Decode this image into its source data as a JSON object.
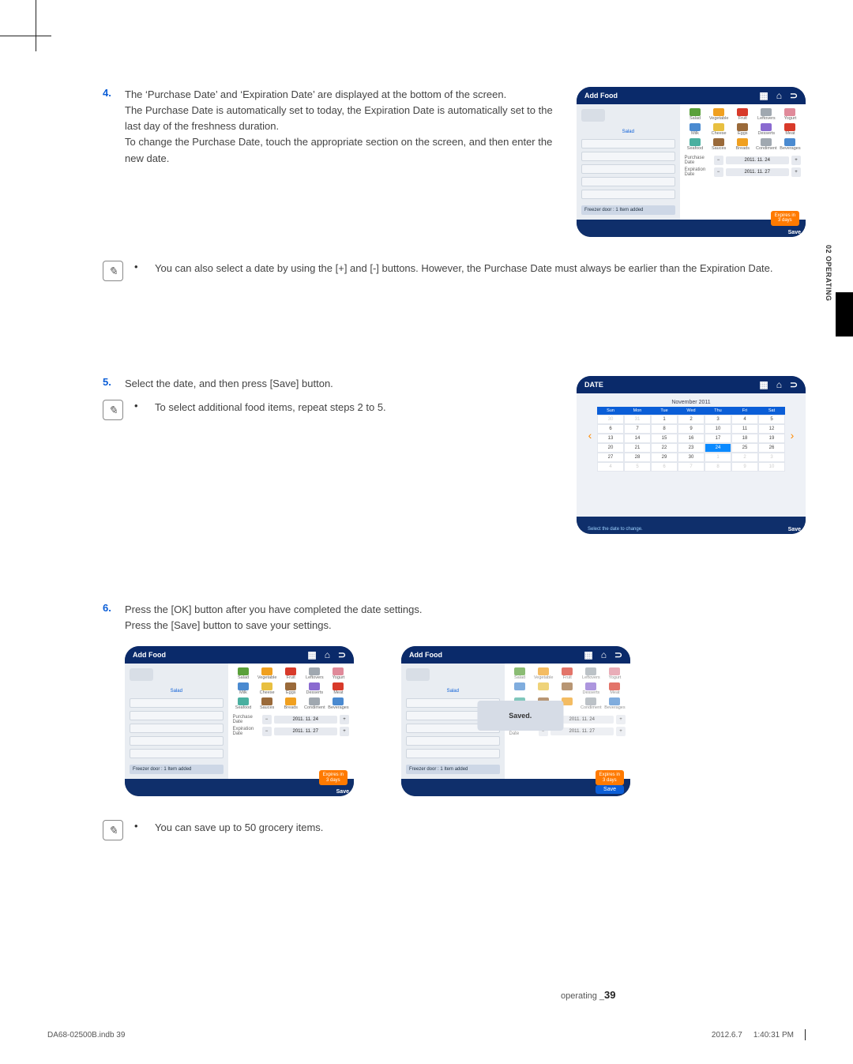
{
  "sideTab": "02 OPERATING",
  "steps": {
    "s4": {
      "num": "4.",
      "p1": "The ‘Purchase Date’ and ‘Expiration Date’ are displayed at the bottom of the screen.",
      "p2": "The Purchase Date is automatically set to today, the Expiration Date is automatically set to the last day of the freshness duration.",
      "p3": "To change the Purchase Date, touch the appropriate section on the screen, and then enter the new date."
    },
    "s5": {
      "num": "5.",
      "p1": "Select the date, and then press [Save] button.",
      "note": "To select additional food items, repeat steps 2 to 5."
    },
    "s6": {
      "num": "6.",
      "p1": "Press the [OK] button after you have completed the date settings.",
      "p2": "Press the [Save] button to save your settings."
    }
  },
  "notes": {
    "n1": "You can also select a date by using the [+] and [-] buttons. However, the Purchase Date must always be earlier than the Expiration Date.",
    "n2": "You can save up to 50 grocery items."
  },
  "addFoodScreen": {
    "title": "Add Food",
    "fridgeFooter": "Freezer door : 1 Item added",
    "fridgeTag": "Salad",
    "categories": [
      "Salad",
      "Vegetable",
      "Fruit",
      "Leftovers",
      "Yogurt",
      "Milk",
      "Cheese",
      "Eggs",
      "Desserts",
      "Meat",
      "Seafood",
      "Sauces",
      "Breads",
      "Condiment",
      "Beverages"
    ],
    "purchaseLabel": "Purchase Date",
    "expirationLabel": "Expiration Date",
    "purchaseDate": "2011. 11. 24",
    "expirationDate": "2011. 11. 27",
    "expiresBadgeL1": "Expires in",
    "expiresBadgeL2": "3 days",
    "saveCorner": "Save",
    "savedPopup": "Saved."
  },
  "dateScreen": {
    "title": "DATE",
    "month": "November 2011",
    "dow": [
      "Sun",
      "Mon",
      "Tue",
      "Wed",
      "Thu",
      "Fri",
      "Sat"
    ],
    "grid": [
      [
        "30",
        "31",
        "1",
        "2",
        "3",
        "4",
        "5"
      ],
      [
        "6",
        "7",
        "8",
        "9",
        "10",
        "11",
        "12"
      ],
      [
        "13",
        "14",
        "15",
        "16",
        "17",
        "18",
        "19"
      ],
      [
        "20",
        "21",
        "22",
        "23",
        "24",
        "25",
        "26"
      ],
      [
        "27",
        "28",
        "29",
        "30",
        "1",
        "2",
        "3"
      ],
      [
        "4",
        "5",
        "6",
        "7",
        "8",
        "9",
        "10"
      ]
    ],
    "selected": "24",
    "hint": "Select the date to change.",
    "saveCorner": "Save"
  },
  "footer": {
    "leftFile": "DA68-02500B.indb   39",
    "pageLabel": "operating _",
    "pageNum": "39",
    "date": "2012.6.7",
    "time": "1:40:31 PM"
  }
}
